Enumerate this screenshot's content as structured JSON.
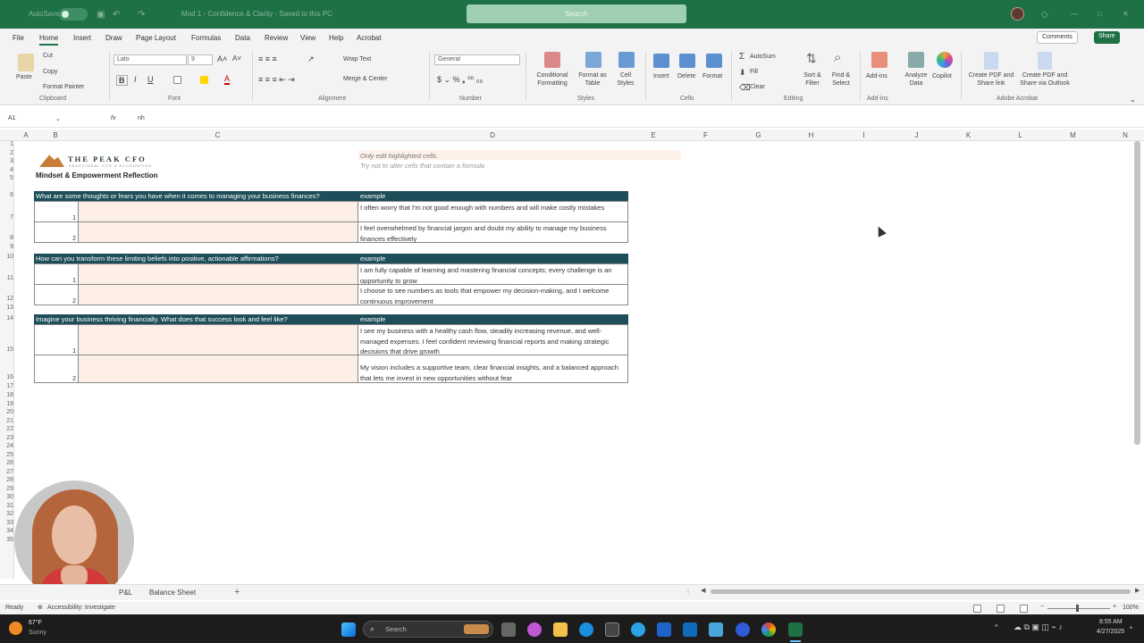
{
  "window": {
    "autosave": "AutoSave",
    "title": "Mod 1 - Confidence & Clarity - Saved to this PC",
    "search_placeholder": "Search"
  },
  "menu": [
    "File",
    "Home",
    "Insert",
    "Draw",
    "Page Layout",
    "Formulas",
    "Data",
    "Review",
    "View",
    "Help",
    "Acrobat"
  ],
  "top_buttons": {
    "comments": "Comments",
    "share": "Share"
  },
  "ribbon": {
    "clipboard": {
      "paste": "Paste",
      "cut": "Cut",
      "copy": "Copy",
      "format_painter": "Format Painter",
      "group": "Clipboard"
    },
    "font": {
      "name": "Lato",
      "size": "9",
      "group": "Font"
    },
    "alignment": {
      "wrap": "Wrap Text",
      "merge": "Merge & Center",
      "group": "Alignment"
    },
    "number": {
      "format": "General",
      "group": "Number"
    },
    "styles": {
      "conditional": "Conditional Formatting",
      "format_table": "Format as Table",
      "cell_styles": "Cell Styles",
      "group": "Styles"
    },
    "cells": {
      "insert": "Insert",
      "delete": "Delete",
      "format": "Format",
      "group": "Cells"
    },
    "editing": {
      "autosum": "AutoSum",
      "fill": "Fill",
      "clear": "Clear",
      "sort": "Sort & Filter",
      "find": "Find & Select",
      "group": "Editing"
    },
    "addins": {
      "label": "Add-ins",
      "group": "Add-ins"
    },
    "analyze": "Analyze Data",
    "copilot": "Copilot",
    "acrobat": {
      "pdf_share": "Create PDF and Share link",
      "pdf_outlook": "Create PDF and Share via Outlook",
      "group": "Adobe Acrobat"
    }
  },
  "formula_bar": {
    "cell": "A1",
    "fx": "fx",
    "content": "nh"
  },
  "columns": [
    "A",
    "B",
    "C",
    "D",
    "E",
    "F",
    "G",
    "H",
    "I",
    "J",
    "K",
    "L",
    "M",
    "N"
  ],
  "rows": [
    "1",
    "2",
    "3",
    "4",
    "5",
    "6",
    "7",
    "8",
    "9",
    "10",
    "11",
    "12",
    "13",
    "14",
    "15",
    "16",
    "17",
    "18",
    "19",
    "20",
    "21",
    "22",
    "23",
    "24",
    "25",
    "26",
    "27",
    "28",
    "29",
    "30",
    "31",
    "32",
    "33",
    "34",
    "35"
  ],
  "sheet": {
    "logo": "THE PEAK CFO",
    "logo_sub": "FRACTIONAL CFO & ACCOUNTING",
    "title": "Mindset & Empowerment Reflection",
    "note1": "Only edit highlighted cells.",
    "note2": "Try not to alter cells that contain a formula",
    "sections": [
      {
        "q": "What are some thoughts or fears you have when it comes to managing your business finances?",
        "example_label": "example",
        "items": [
          {
            "n": "1",
            "text": "I often worry that I'm not good enough with numbers and will make costly mistakes"
          },
          {
            "n": "2",
            "text": "I feel overwhelmed by financial jargon and doubt my ability to manage my business finances effectively"
          }
        ]
      },
      {
        "q": "How can you transform these limiting beliefs into positive, actionable affirmations?",
        "example_label": "example",
        "items": [
          {
            "n": "1",
            "text": "I am fully capable of learning and mastering financial concepts; every challenge is an opportunity to grow"
          },
          {
            "n": "2",
            "text": "I choose to see numbers as tools that empower my decision-making, and I welcome continuous improvement"
          }
        ]
      },
      {
        "q": "Imagine your business thriving financially. What does that success look and feel like?",
        "example_label": "example",
        "items": [
          {
            "n": "1",
            "text": "I see my business with a healthy cash flow, steadily increasing revenue, and well-managed expenses. I feel confident reviewing financial reports and making strategic decisions that drive growth"
          },
          {
            "n": "2",
            "text": "My vision includes a supportive team, clear financial insights, and a balanced approach that lets me invest in new opportunities without fear"
          }
        ]
      }
    ]
  },
  "tabs": [
    "P&L",
    "Balance Sheet"
  ],
  "status": {
    "ready": "Ready",
    "accessibility": "Accessibility: Investigate",
    "zoom": "100%"
  },
  "taskbar": {
    "weather_temp": "67°F",
    "weather_desc": "Sunny",
    "search": "Search",
    "time": "8:55 AM",
    "date": "4/27/2025"
  }
}
